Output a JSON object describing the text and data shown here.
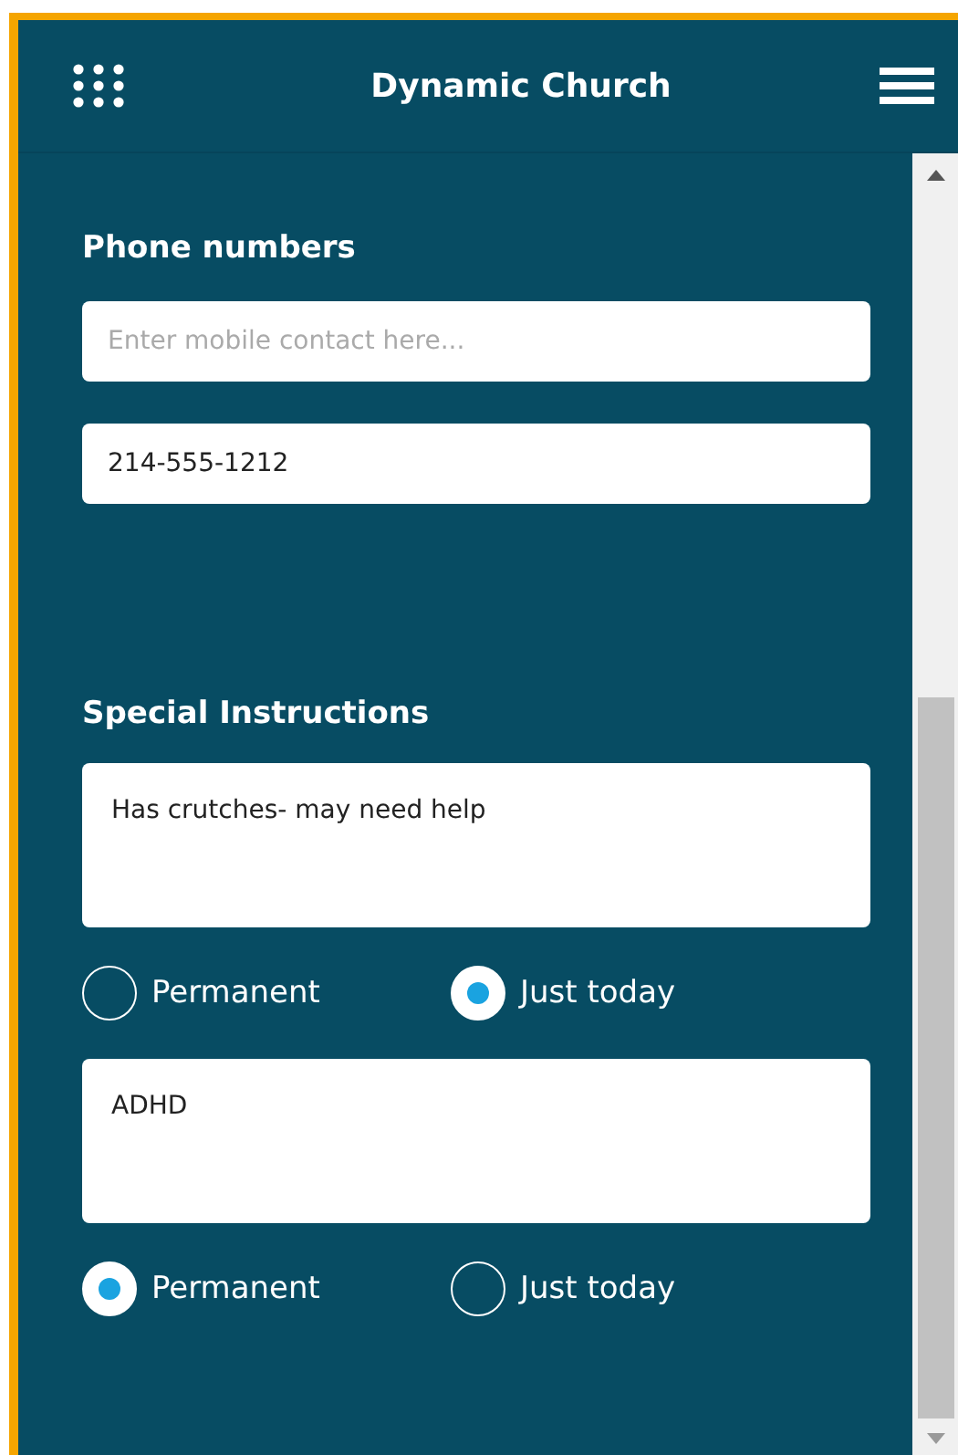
{
  "header": {
    "title": "Dynamic Church"
  },
  "phone_numbers": {
    "label": "Phone numbers",
    "fields": [
      {
        "placeholder": "Enter mobile contact here..."
      },
      {
        "value": "214-555-1212"
      }
    ]
  },
  "special_instructions": {
    "label": "Special Instructions",
    "entries": [
      {
        "value": "Has crutches- may need help",
        "options": [
          {
            "label": "Permanent",
            "selected": false
          },
          {
            "label": "Just today",
            "selected": true
          }
        ]
      },
      {
        "value": "ADHD",
        "options": [
          {
            "label": "Permanent",
            "selected": true
          },
          {
            "label": "Just today",
            "selected": false
          }
        ]
      }
    ]
  }
}
